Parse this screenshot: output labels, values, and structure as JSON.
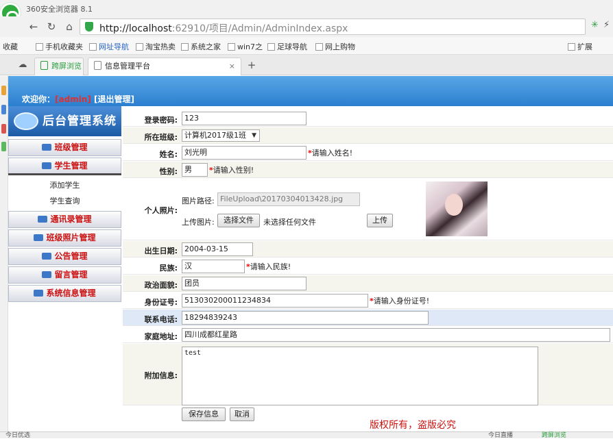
{
  "browser": {
    "app_title": "360安全浏览器 8.1",
    "url_host": "http://localhost",
    "url_rest": ":62910/项目/Admin/AdminIndex.aspx",
    "bookmarks": [
      "收藏",
      "手机收藏夹",
      "网址导航",
      "淘宝热卖",
      "系统之家",
      "win7之",
      "足球导航",
      "网上购物",
      "扩展"
    ],
    "tabs": [
      "跨屏浏览",
      "信息管理平台"
    ],
    "tab_close": "×",
    "new_tab": "+",
    "status_left": "今日优选",
    "status_right": [
      "今日直播",
      "跨屏浏览"
    ]
  },
  "header": {
    "welcome": "欢迎你：",
    "user": "[admin]",
    "logout": "[退出管理]"
  },
  "sidebar": {
    "title": "后台管理系统",
    "menu": [
      "班级管理",
      "学生管理",
      "通讯录管理",
      "班级照片管理",
      "公告管理",
      "留言管理",
      "系统信息管理"
    ],
    "submenu": [
      "添加学生",
      "学生查询"
    ]
  },
  "form": {
    "password_label": "登录密码:",
    "password_value": "123",
    "class_label": "所在班级:",
    "class_value": "计算机2017级1班",
    "name_label": "姓名:",
    "name_value": "刘光明",
    "name_hint": "请输入姓名!",
    "gender_label": "性别:",
    "gender_value": "男",
    "gender_hint": "请输入性别!",
    "photo_label": "个人照片:",
    "photo_path_label": "图片路径:",
    "photo_path_value": "FileUpload\\20170304013428.jpg",
    "upload_label": "上传图片:",
    "choose_file": "选择文件",
    "no_file": "未选择任何文件",
    "upload_button": "上传",
    "birthday_label": "出生日期:",
    "birthday_value": "2004-03-15",
    "nation_label": "民族:",
    "nation_value": "汉",
    "nation_hint": "请输入民族!",
    "politics_label": "政治面貌:",
    "politics_value": "团员",
    "idcard_label": "身份证号:",
    "idcard_value": "513030200011234834",
    "idcard_hint": "请输入身份证号!",
    "phone_label": "联系电话:",
    "phone_value": "18294839243",
    "address_label": "家庭地址:",
    "address_value": "四川成都红星路",
    "extra_label": "附加信息:",
    "extra_value": "test",
    "save_button": "保存信息",
    "cancel_button": "取消",
    "required_mark": "*"
  },
  "copyright": "版权所有，盗版必究"
}
